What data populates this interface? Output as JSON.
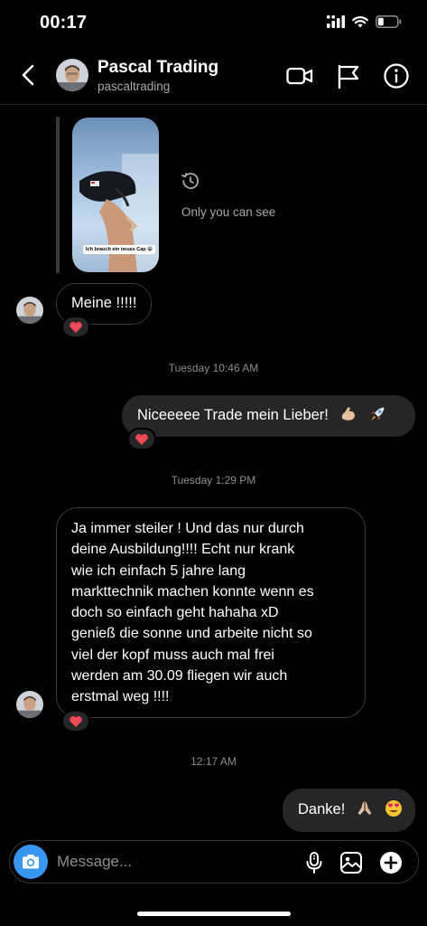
{
  "status_bar": {
    "time": "00:17"
  },
  "header": {
    "name": "Pascal Trading",
    "username": "pascaltrading"
  },
  "story_reply": {
    "caption": "Ich brauch ein neues Cap 😁",
    "label": "Only you can see"
  },
  "messages": [
    {
      "id": "m1",
      "sender": "them",
      "text": "Meine !!!!!",
      "reaction": "❤️"
    },
    {
      "type": "timestamp",
      "text": "Tuesday 10:46 AM"
    },
    {
      "id": "m2",
      "sender": "me",
      "text": "Niceeeee Trade mein Lieber!",
      "emojis": [
        "💪🏼",
        "🚀"
      ],
      "reaction": "❤️"
    },
    {
      "type": "timestamp",
      "text": "Tuesday 1:29 PM"
    },
    {
      "id": "m3",
      "sender": "them",
      "lines": [
        "Ja immer steiler ! Und das nur durch",
        "deine Ausbildung!!!! Echt nur krank",
        "wie ich einfach 5 jahre lang",
        "markttechnik machen konnte wenn es",
        "doch so einfach geht hahaha xD",
        "genieß die sonne und arbeite nicht so",
        "viel der kopf muss auch mal frei",
        "werden am 30.09 fliegen wir auch",
        "erstmal weg !!!!"
      ],
      "reaction": "❤️"
    },
    {
      "type": "timestamp",
      "text": "12:17 AM"
    },
    {
      "id": "m4",
      "sender": "me",
      "text": "Danke!",
      "emojis": [
        "🙏🏼",
        "😍"
      ]
    }
  ],
  "composer": {
    "placeholder": "Message..."
  },
  "colors": {
    "accent": "#3797f0",
    "reaction_heart": "#ed4956",
    "bubble_out": "#262626"
  }
}
